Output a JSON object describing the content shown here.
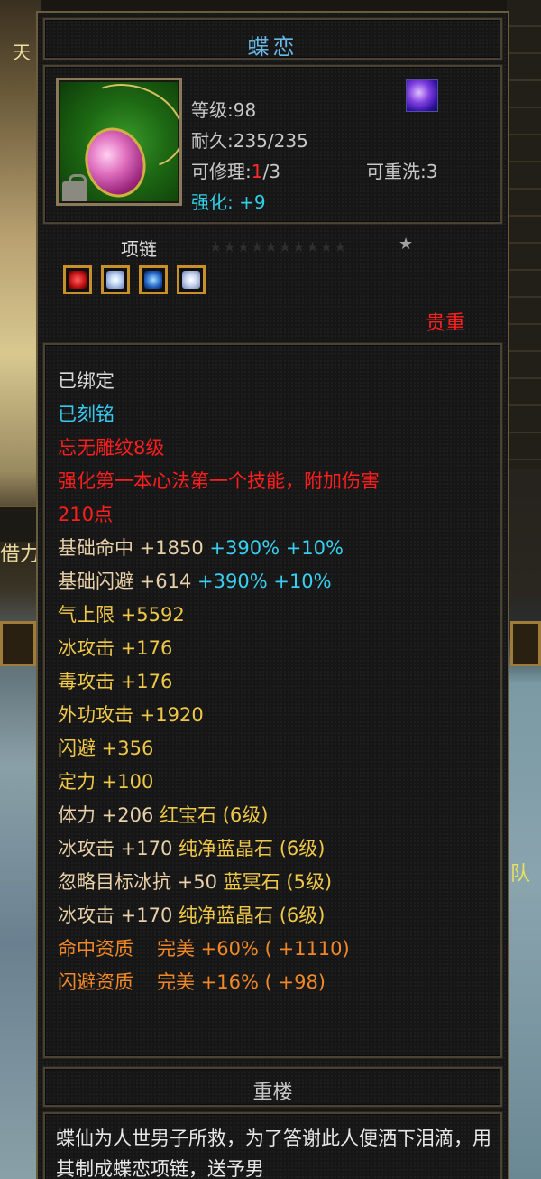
{
  "background": {
    "left_text": "天",
    "left_text2": "借力",
    "right_text": "队"
  },
  "item": {
    "name": "蝶恋",
    "level": "等级:98",
    "durability": "耐久:235/235",
    "repair_prefix": "可修理:",
    "repair_used": "1",
    "repair_total": "/3",
    "rewash": "可重洗:3",
    "enhance": "强化: +9",
    "type": "项链",
    "stars_dim": "★★★★★★★★★★",
    "star": "★",
    "rarity": "贵重"
  },
  "stats": [
    {
      "text": "已绑定",
      "color": "white"
    },
    {
      "text": "已刻铭",
      "color": "cyan"
    },
    {
      "text": "忘无雕纹8级",
      "color": "red"
    },
    {
      "text": "强化第一本心法第一个技能，附加伤害",
      "color": "red"
    },
    {
      "text": "210点",
      "color": "red"
    },
    {
      "base": "基础命中 +1850",
      "extra": " +390% +10%",
      "color": "beige"
    },
    {
      "base": "基础闪避 +614",
      "extra": " +390% +10%",
      "color": "beige"
    },
    {
      "text": "气上限 +5592",
      "color": "yellow"
    },
    {
      "text": "冰攻击 +176",
      "color": "yellow"
    },
    {
      "text": "毒攻击 +176",
      "color": "yellow"
    },
    {
      "text": "外功攻击 +1920",
      "color": "yellow"
    },
    {
      "text": "闪避 +356",
      "color": "yellow"
    },
    {
      "text": "定力 +100",
      "color": "yellow"
    },
    {
      "base": "体力 +206 ",
      "extra": "红宝石 (6级)",
      "color": "beige2"
    },
    {
      "base": "冰攻击 +170 ",
      "extra": "纯净蓝晶石 (6级)",
      "color": "beige2"
    },
    {
      "base": "忽略目标冰抗 +50 ",
      "extra": "蓝冥石 (5级)",
      "color": "beige2"
    },
    {
      "base": "冰攻击 +170 ",
      "extra": "纯净蓝晶石 (6级)",
      "color": "beige2"
    },
    {
      "base": "命中资质",
      "extra": "完美 +60% ( +1110)",
      "color": "orange"
    },
    {
      "base": "闪避资质",
      "extra": "完美 +16% ( +98)",
      "color": "orange"
    }
  ],
  "description": {
    "title": "重楼",
    "text": "蝶仙为人世男子所救，为了答谢此人便洒下泪滴，用其制成蝶恋项链，送予男"
  },
  "colors": {
    "title": "#6ab8e8",
    "red": "#ff1e1e",
    "cyan": "#38c8f0",
    "yellow": "#f0c848",
    "orange": "#f08828",
    "beige": "#e8d0a8"
  }
}
